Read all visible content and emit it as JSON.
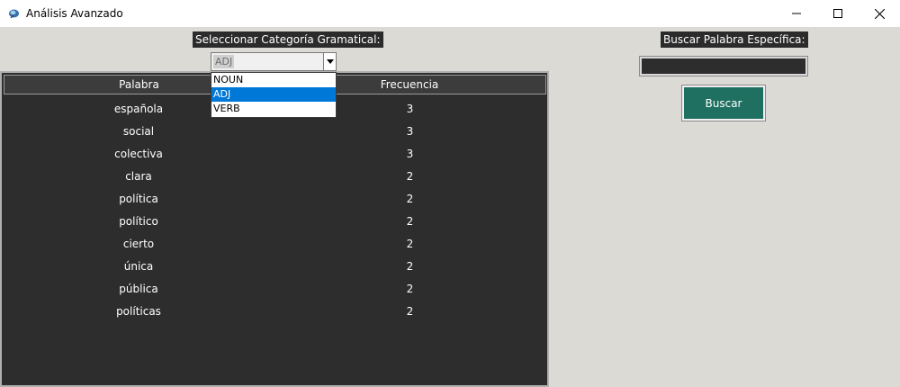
{
  "window": {
    "title": "Análisis Avanzado",
    "icon": "feather-app-icon",
    "controls": {
      "minimize": "—",
      "maximize": "☐",
      "close": "✕"
    }
  },
  "category": {
    "label": "Seleccionar Categoría Gramatical:",
    "selected": "ADJ",
    "options": [
      "NOUN",
      "ADJ",
      "VERB"
    ],
    "highlighted_index": 1
  },
  "table": {
    "headers": {
      "word": "Palabra",
      "frequency": "Frecuencia"
    },
    "rows": [
      {
        "word": "española",
        "frequency": "3"
      },
      {
        "word": "social",
        "frequency": "3"
      },
      {
        "word": "colectiva",
        "frequency": "3"
      },
      {
        "word": "clara",
        "frequency": "2"
      },
      {
        "word": "política",
        "frequency": "2"
      },
      {
        "word": "político",
        "frequency": "2"
      },
      {
        "word": "cierto",
        "frequency": "2"
      },
      {
        "word": "única",
        "frequency": "2"
      },
      {
        "word": "pública",
        "frequency": "2"
      },
      {
        "word": "políticas",
        "frequency": "2"
      }
    ]
  },
  "search": {
    "label": "Buscar Palabra Específica:",
    "value": "",
    "button_label": "Buscar"
  },
  "colors": {
    "background": "#dcdad5",
    "dark_panel": "#2d2d2d",
    "button": "#1f7060",
    "selection": "#0078d7"
  }
}
